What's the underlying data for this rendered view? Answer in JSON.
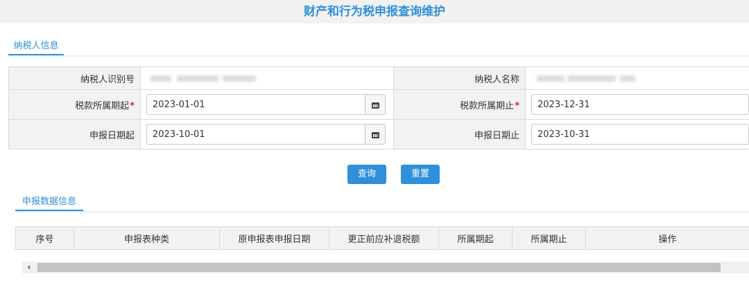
{
  "page": {
    "title": "财产和行为税申报查询维护"
  },
  "taxpayer_section": {
    "tab_label": "纳税人信息"
  },
  "form": {
    "tin_label": "纳税人识别号",
    "name_label": "纳税人名称",
    "period_start_label": "税款所属期起",
    "period_end_label": "税款所属期止",
    "required_mark": "*",
    "period_start_value": "2023-01-01",
    "period_end_value": "2023-12-31",
    "declare_start_label": "申报日期起",
    "declare_end_label": "申报日期止",
    "declare_start_value": "2023-10-01",
    "declare_end_value": "2023-10-31",
    "calendar_icon": "calendar-icon"
  },
  "actions": {
    "query_label": "查询",
    "reset_label": "重置"
  },
  "data_section": {
    "tab_label": "申报数据信息"
  },
  "grid": {
    "columns": [
      "序号",
      "申报表种类",
      "原申报表申报日期",
      "更正前应补退税额",
      "所属期起",
      "所属期止",
      "操作"
    ]
  },
  "scrollbar": {
    "left_arrow": "‹"
  },
  "colors": {
    "accent": "#2f8fd8",
    "required": "#e02020",
    "label_bg": "#f2f2f2"
  }
}
